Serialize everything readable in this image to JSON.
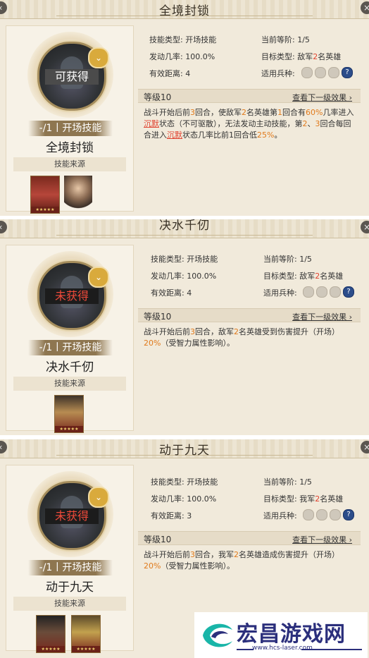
{
  "common": {
    "type_label": "技能类型:",
    "type_value": "开场技能",
    "order_label": "当前等阶:",
    "order_value": "1/5",
    "rate_label": "发动几率:",
    "rate_value": "100.0%",
    "target_label": "目标类型:",
    "range_label": "有效距离:",
    "troop_label": "适用兵种:",
    "level_label": "等级10",
    "next_label": "查看下一级效果 ›",
    "banner": "-/1丨开场技能",
    "source": "技能来源",
    "stars": "★★★★★",
    "help_icon": "?"
  },
  "panels": [
    {
      "title": "全境封锁",
      "status": "可获得",
      "skill_name": "全境封锁",
      "target_pre": "敌军",
      "target_num": "2",
      "target_post": "名英雄",
      "range": "4",
      "desc": {
        "a": "战斗开始后前",
        "b": "3",
        "c": "回合，使敌军",
        "d": "2",
        "e": "名英雄第",
        "f": "1",
        "g": "回合有",
        "h": "60%",
        "i": "几率进入",
        "j": "沉默",
        "k": "状态（不可驱散），无法发动主动技能，第",
        "l": "2",
        "m": "、",
        "n": "3",
        "o": "回合每回合进入",
        "p": "沉默",
        "q": "状态几率比前1回合低",
        "r": "25%",
        "s": "。"
      }
    },
    {
      "title": "决水千仞",
      "status": "未获得",
      "skill_name": "决水千仞",
      "target_pre": "敌军",
      "target_num": "2",
      "target_post": "名英雄",
      "range": "4",
      "desc": {
        "a": "战斗开始后前",
        "b": "3",
        "c": "回合，敌军",
        "d": "2",
        "e": "名英雄受到伤害提升（开场）",
        "f": "20%",
        "g": "（受智力属性影响）。"
      }
    },
    {
      "title": "动于九天",
      "status": "未获得",
      "skill_name": "动于九天",
      "target_pre": "我军",
      "target_num": "2",
      "target_post": "名英雄",
      "range": "3",
      "desc": {
        "a": "战斗开始后前",
        "b": "3",
        "c": "回合，我军",
        "d": "2",
        "e": "名英雄造成伤害提升（开场）",
        "f": "20%",
        "g": "（受智力属性影响）。"
      }
    }
  ],
  "watermark": {
    "title": "宏昌游戏网",
    "url": "www.hcs-laser.com"
  }
}
